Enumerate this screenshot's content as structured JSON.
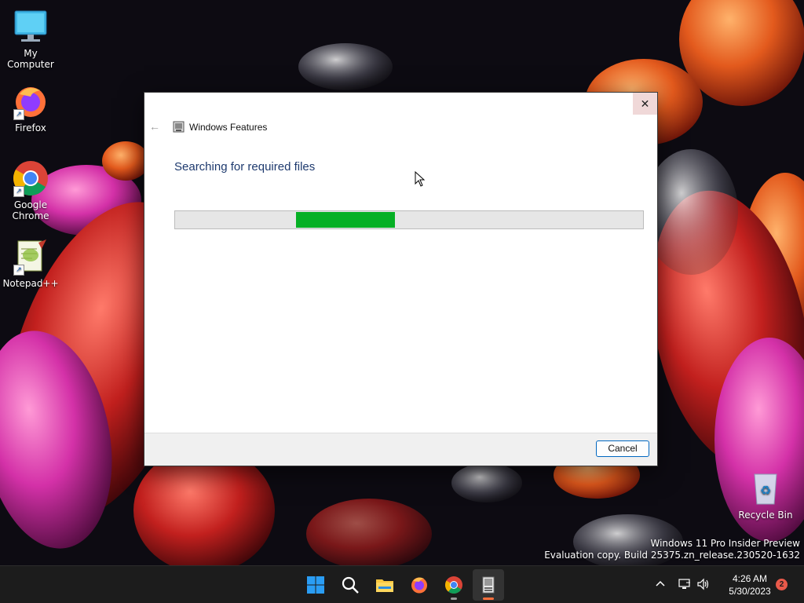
{
  "desktop": {
    "icons": [
      {
        "label": "My Computer",
        "icon": "computer-icon"
      },
      {
        "label": "Firefox",
        "icon": "firefox-icon"
      },
      {
        "label": "Google Chrome",
        "icon": "chrome-icon"
      },
      {
        "label": "Notepad++",
        "icon": "notepadpp-icon"
      },
      {
        "label": "Recycle Bin",
        "icon": "recycle-bin-icon"
      }
    ],
    "watermark": {
      "line1": "Windows 11 Pro Insider Preview",
      "line2": "Evaluation copy. Build 25375.zn_release.230520-1632"
    }
  },
  "dialog": {
    "title": "Windows Features",
    "heading": "Searching for required files",
    "progress": {
      "start_fraction": 0.259,
      "end_fraction": 0.47,
      "mode": "indeterminate"
    },
    "cancel_label": "Cancel",
    "close_glyph": "✕",
    "back_glyph": "←"
  },
  "taskbar": {
    "apps": [
      "start-icon",
      "search-icon",
      "file-explorer-icon",
      "firefox-icon",
      "chrome-icon",
      "windows-features-icon"
    ],
    "clock": {
      "time": "4:26 AM",
      "date": "5/30/2023"
    },
    "notification_count": "2"
  },
  "colors": {
    "accent": "#0067c0",
    "progress": "#06b025",
    "heading": "#1e3a6e"
  }
}
